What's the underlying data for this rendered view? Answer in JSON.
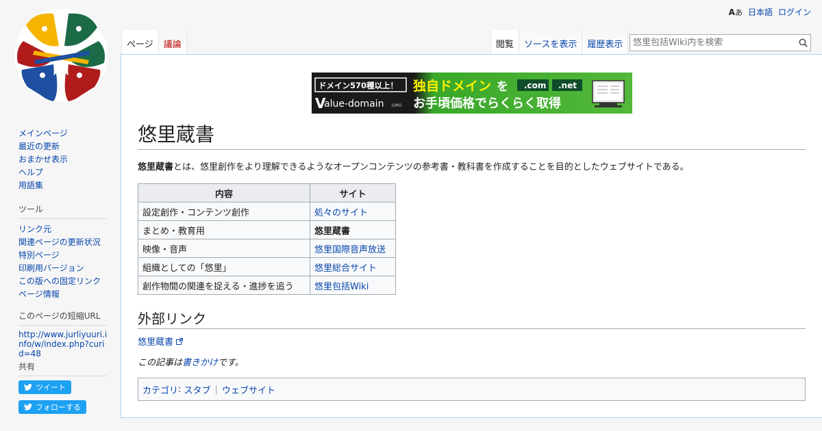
{
  "personal": {
    "language": "日本語",
    "login": "ログイン"
  },
  "tabs": {
    "left": [
      {
        "label": "ページ"
      },
      {
        "label": "議論"
      }
    ],
    "right": [
      {
        "label": "閲覧"
      },
      {
        "label": "ソースを表示"
      },
      {
        "label": "履歴表示"
      }
    ]
  },
  "search": {
    "placeholder": "悠里包括Wiki内を検索"
  },
  "banner": {
    "badge": "ドメイン570種以上！",
    "headline_1": "独自ドメイン",
    "headline_1b": "を",
    "headline_2": "お手頃価格でらくらく取得",
    "com": ".com",
    "net": ".net",
    "brand": "alue-domain",
    "brand_v": "V",
    "brand_sub": ".GMO"
  },
  "page": {
    "title": "悠里蔵書",
    "intro_bold": "悠里蔵書",
    "intro_rest": "とは、悠里創作をより理解できるようなオープンコンテンツの参考書・教科書を作成することを目的としたウェブサイトである。"
  },
  "table": {
    "headers": [
      "内容",
      "サイト"
    ],
    "rows": [
      {
        "content": "設定創作・コンテンツ創作",
        "site": "処々のサイト",
        "link": true
      },
      {
        "content": "まとめ・教育用",
        "site": "悠里蔵書",
        "link": false
      },
      {
        "content": "映像・音声",
        "site": "悠里国際音声放送",
        "link": true
      },
      {
        "content": "組織としての「悠里」",
        "site": "悠里総合サイト",
        "link": true
      },
      {
        "content": "創作物間の関連を捉える・進捗を追う",
        "site": "悠里包括Wiki",
        "link": true
      }
    ]
  },
  "external": {
    "heading": "外部リンク",
    "link": "悠里蔵書"
  },
  "stub": {
    "before": "この記事は",
    "link": "書きかけ",
    "after": "です。"
  },
  "categories": {
    "label": "カテゴリ",
    "items": [
      "スタブ",
      "ウェブサイト"
    ]
  },
  "sidebar": {
    "nav": [
      "メインページ",
      "最近の更新",
      "おまかせ表示",
      "ヘルプ",
      "用語集"
    ],
    "tools_heading": "ツール",
    "tools": [
      "リンク元",
      "関連ページの更新状況",
      "特別ページ",
      "印刷用バージョン",
      "この版への固定リンク",
      "ページ情報"
    ],
    "short_heading": "このページの短縮URL",
    "short_url": "http://www.jurliyuuri.info/w/index.php?curid=48",
    "share_heading": "共有",
    "tweet": "ツイート",
    "follow": "フォローする"
  },
  "colors": {
    "link": "#0645ad",
    "redlink": "#ba0000",
    "border": "#a7d7f9",
    "twitter": "#1da1f2"
  }
}
